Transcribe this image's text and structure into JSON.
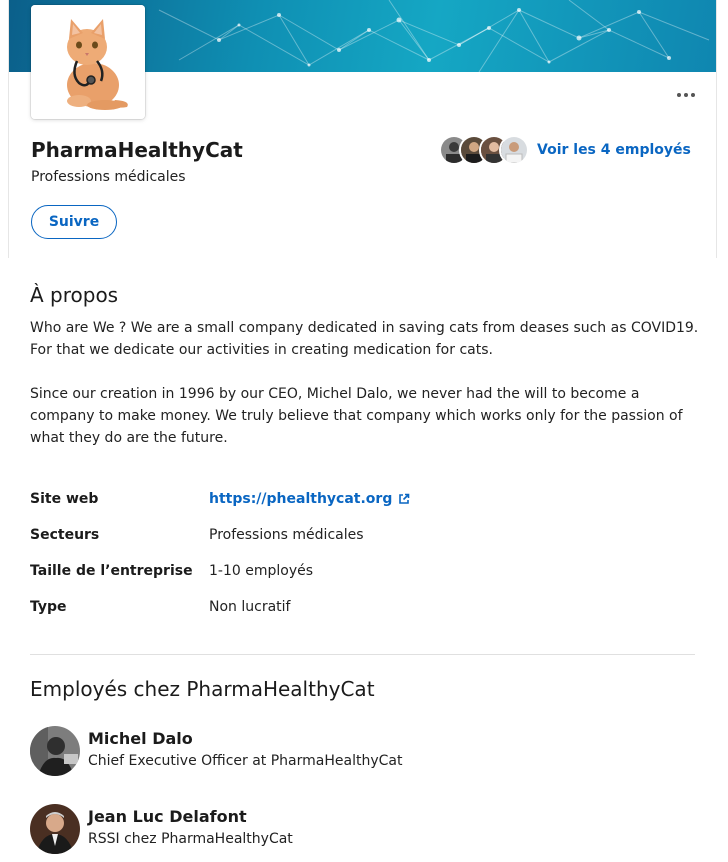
{
  "company": {
    "name": "PharmaHealthyCat",
    "industry": "Professions médicales",
    "follow_label": "Suivre",
    "employees_link": "Voir les 4 employés"
  },
  "about": {
    "title": "À propos",
    "paragraph1": " Who are We ? We are a small company dedicated in saving cats from deases such as COVID19. For that we dedicate our activities in creating medication for cats.",
    "paragraph2": "Since our creation in 1996 by our CEO, Michel Dalo, we never had the will to become a company to make money. We truly believe that company which works only for the passion of what they do are the future."
  },
  "details": [
    {
      "label": "Site web",
      "value": "https://phealthycat.org"
    },
    {
      "label": "Secteurs",
      "value": "Professions médicales"
    },
    {
      "label": "Taille de l’entreprise",
      "value": "1-10 employés"
    },
    {
      "label": "Type",
      "value": "Non lucratif"
    }
  ],
  "employees": {
    "title": "Employés chez PharmaHealthyCat",
    "list": [
      {
        "name": "Michel Dalo",
        "title": "Chief Executive Officer at PharmaHealthyCat"
      },
      {
        "name": "Jean Luc Delafont",
        "title": "RSSI chez PharmaHealthyCat"
      }
    ]
  },
  "colors": {
    "accent": "#0a66c2",
    "banner": "#0f8fb3"
  }
}
